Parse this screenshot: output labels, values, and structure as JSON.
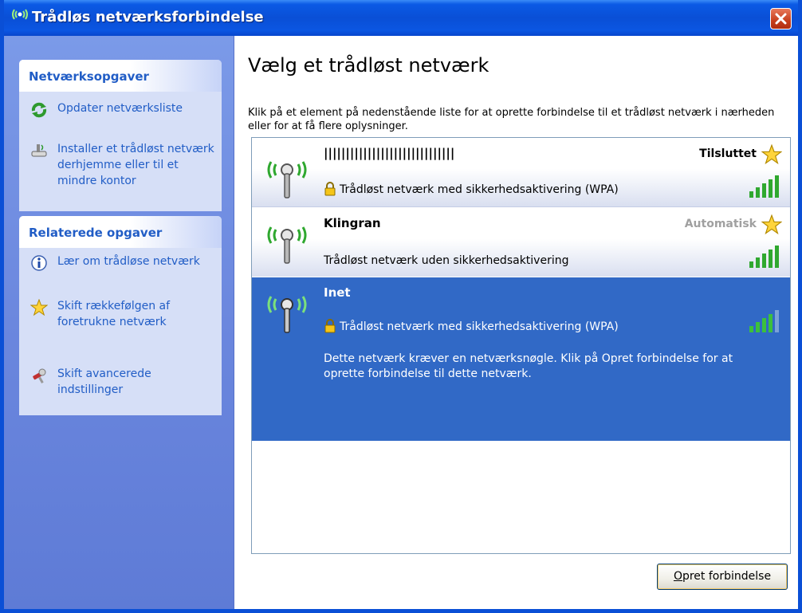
{
  "window": {
    "title": "Trådløs netværksforbindelse"
  },
  "sidebar": {
    "network_tasks": {
      "header": "Netværksopgaver",
      "items": [
        {
          "label": "Opdater netværksliste",
          "icon": "refresh-icon"
        },
        {
          "label": "Installer et trådløst netværk derhjemme eller til et mindre kontor",
          "icon": "network-setup-icon"
        }
      ]
    },
    "related_tasks": {
      "header": "Relaterede opgaver",
      "items": [
        {
          "label": "Lær om trådløse netværk",
          "icon": "info-icon"
        },
        {
          "label": "Skift rækkefølgen af foretrukne netværk",
          "icon": "star-icon"
        },
        {
          "label": "Skift avancerede indstillinger",
          "icon": "settings-icon"
        }
      ]
    }
  },
  "main": {
    "title": "Vælg et trådløst netværk",
    "intro": "Klik på et element på nedenstående liste for at oprette forbindelse til et trådløst netværk i nærheden eller for at få flere oplysninger.",
    "networks": [
      {
        "ssid": "||||||||||||||||||||||||||||||",
        "status": "Tilsluttet",
        "security": "Trådløst netværk med sikkerhedsaktivering (WPA)",
        "secured": true,
        "signal_bars": 5
      },
      {
        "ssid": "Klingran",
        "status": "Automatisk",
        "security": "Trådløst netværk uden sikkerhedsaktivering",
        "secured": false,
        "signal_bars": 5
      },
      {
        "ssid": "Inet",
        "status": "",
        "security": "Trådløst netværk med sikkerhedsaktivering (WPA)",
        "secured": true,
        "signal_bars": 4,
        "selected": true,
        "details": "Dette netværk kræver en netværksnøgle. Klik på Opret forbindelse for at oprette forbindelse til dette netværk."
      }
    ],
    "connect_button": {
      "accesskey": "O",
      "rest": "pret forbindelse"
    }
  },
  "colors": {
    "titlebar": "#0a4fd6",
    "sidebar": "#6f8fe6",
    "task_link": "#215dc6",
    "selection": "#3169c6",
    "signal": "#2fa82f"
  }
}
